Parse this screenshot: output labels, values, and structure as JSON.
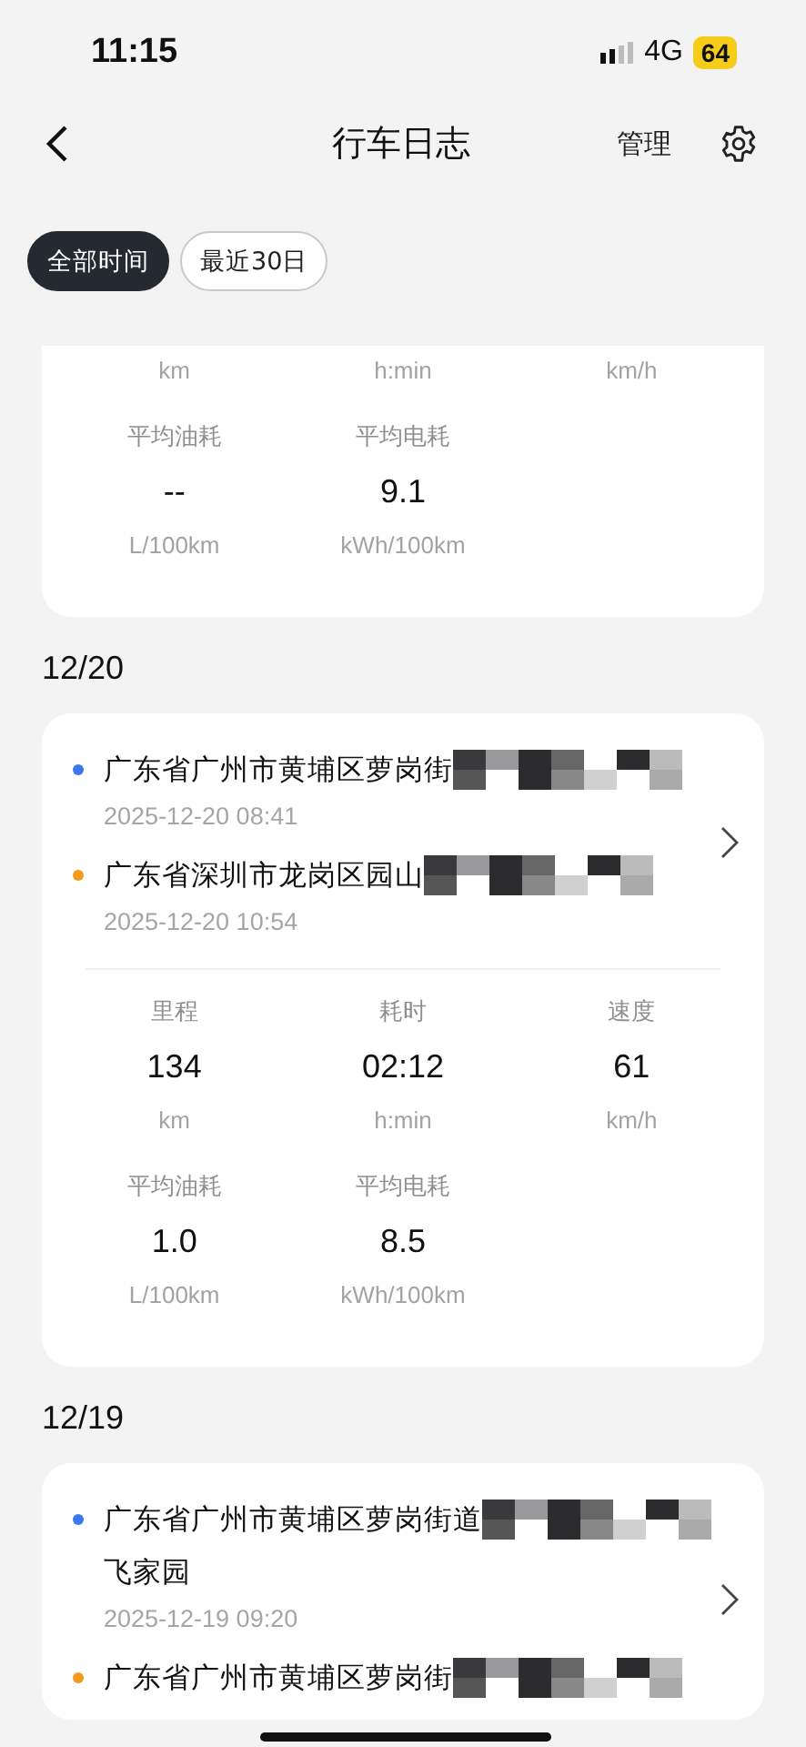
{
  "status_bar": {
    "time": "11:15",
    "network": "4G",
    "battery": "64"
  },
  "nav": {
    "title": "行车日志",
    "action": "管理"
  },
  "filters": [
    {
      "label": "全部时间",
      "selected": true
    },
    {
      "label": "最近30日",
      "selected": false
    }
  ],
  "sections": [
    {
      "cards": [
        {
          "metrics": [
            [
              {
                "unit": "km"
              },
              {
                "unit": "h:min"
              },
              {
                "unit": "km/h"
              }
            ],
            [
              {
                "label": "平均油耗",
                "value": "--",
                "unit": "L/100km"
              },
              {
                "label": "平均电耗",
                "value": "9.1",
                "unit": "kWh/100km"
              }
            ]
          ]
        }
      ]
    },
    {
      "date": "12/20",
      "cards": [
        {
          "trip": [
            {
              "kind": "start",
              "lines": [
                "广东省广州市黄埔区萝岗街"
              ],
              "redacted": true,
              "time": "2025-12-20 08:41"
            },
            {
              "kind": "end",
              "lines": [
                "广东省深圳市龙岗区园山"
              ],
              "redacted": true,
              "time": "2025-12-20 10:54"
            }
          ],
          "metrics": [
            [
              {
                "label": "里程",
                "value": "134",
                "unit": "km"
              },
              {
                "label": "耗时",
                "value": "02:12",
                "unit": "h:min"
              },
              {
                "label": "速度",
                "value": "61",
                "unit": "km/h"
              }
            ],
            [
              {
                "label": "平均油耗",
                "value": "1.0",
                "unit": "L/100km"
              },
              {
                "label": "平均电耗",
                "value": "8.5",
                "unit": "kWh/100km"
              }
            ]
          ]
        }
      ]
    },
    {
      "date": "12/19",
      "cards": [
        {
          "trip": [
            {
              "kind": "start",
              "lines": [
                "广东省广州市黄埔区萝岗街道",
                "飞家园"
              ],
              "redacted": true,
              "time": "2025-12-19 09:20"
            },
            {
              "kind": "end",
              "lines": [
                "广东省广州市黄埔区萝岗街"
              ],
              "redacted": true
            }
          ]
        }
      ]
    }
  ]
}
